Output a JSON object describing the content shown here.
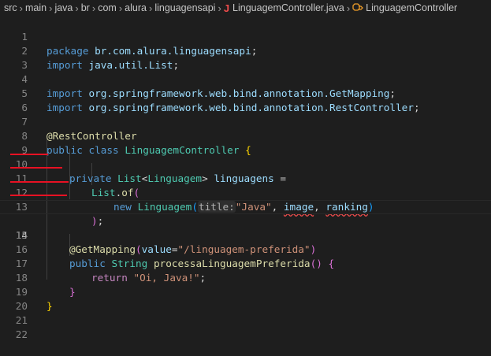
{
  "breadcrumb": {
    "items": [
      "src",
      "main",
      "java",
      "br",
      "com",
      "alura",
      "linguagensapi"
    ],
    "file": "LinguagemController.java",
    "symbol": "LinguagemController"
  },
  "editor": {
    "active_line": 14,
    "line_numbers": [
      "1",
      "2",
      "3",
      "4",
      "5",
      "6",
      "7",
      "8",
      "9",
      "10",
      "11",
      "12",
      "13",
      "14",
      "15",
      "16",
      "17",
      "18",
      "19",
      "20",
      "21",
      "22"
    ],
    "lines": {
      "l1": {
        "a": "package ",
        "b": "br.com.alura.linguagensapi",
        "c": ";"
      },
      "l2": {
        "a": "import ",
        "b": "java.util.List",
        "c": ";"
      },
      "l4": {
        "a": "import ",
        "b": "org.springframework.web.bind.annotation.GetMapping",
        "c": ";"
      },
      "l5": {
        "a": "import ",
        "b": "org.springframework.web.bind.annotation.RestController",
        "c": ";"
      },
      "l7": {
        "a": "@RestController"
      },
      "l8": {
        "a": "public",
        "b": " ",
        "c": "class",
        "d": " ",
        "e": "LinguagemController",
        "f": " ",
        "g": "{"
      },
      "l10": {
        "a": "private",
        "b": " ",
        "c": "List",
        "d": "<",
        "e": "Linguagem",
        "f": "> ",
        "g": "linguagens",
        "h": " ="
      },
      "l11": {
        "a": "List",
        "b": ".",
        "c": "of",
        "d": "("
      },
      "l12": {
        "a": "new",
        "b": " ",
        "c": "Linguagem",
        "d": "(",
        "e": "title:",
        "f": "\"Java\"",
        "g": ", ",
        "h": "image",
        "i": ", ",
        "j": "ranking",
        "k": ")"
      },
      "l13": {
        "a": ")",
        "b": ";"
      },
      "l15": {
        "a": "@GetMapping",
        "b": "(",
        "c": "value",
        "d": "=",
        "e": "\"/linguagem-preferida\"",
        "f": ")"
      },
      "l16": {
        "a": "public",
        "b": " ",
        "c": "String",
        "d": " ",
        "e": "processaLinguagemPreferida",
        "f": "()",
        "g": " ",
        "h": "{"
      },
      "l17": {
        "a": "return",
        "b": " ",
        "c": "\"Oi, Java!\"",
        "d": ";"
      },
      "l18": {
        "a": "}"
      },
      "l19": {
        "a": "}"
      }
    }
  },
  "colors": {
    "background": "#1e1e1e",
    "keyword": "#569cd6",
    "type": "#4ec9b0",
    "string": "#ce9178",
    "annotation_mark": "#e81123"
  },
  "icons": {
    "java_file": "J",
    "class_symbol": "class-icon"
  }
}
